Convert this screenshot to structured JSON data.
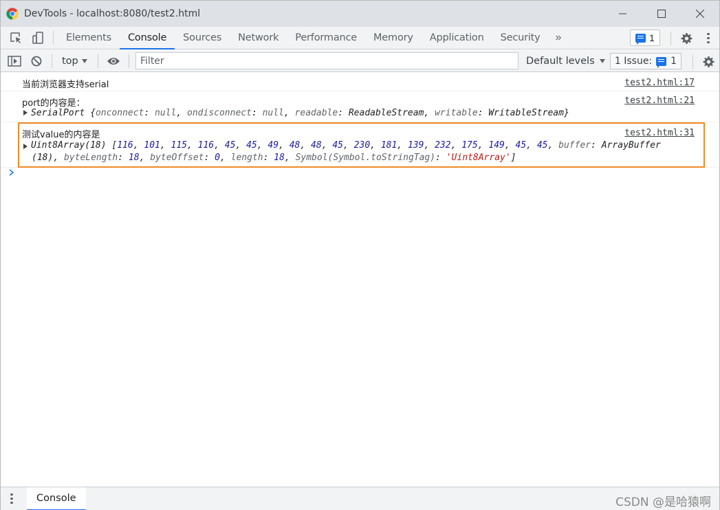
{
  "window": {
    "title": "DevTools - localhost:8080/test2.html",
    "controls": [
      "minimize",
      "maximize",
      "close"
    ]
  },
  "tabs": [
    {
      "label": "Elements",
      "active": false
    },
    {
      "label": "Console",
      "active": true
    },
    {
      "label": "Sources",
      "active": false
    },
    {
      "label": "Network",
      "active": false
    },
    {
      "label": "Performance",
      "active": false
    },
    {
      "label": "Memory",
      "active": false
    },
    {
      "label": "Application",
      "active": false
    },
    {
      "label": "Security",
      "active": false
    }
  ],
  "tab_more": "»",
  "issues_badge_count": "1",
  "console_toolbar": {
    "context": "top",
    "filter_placeholder": "Filter",
    "levels": "Default levels",
    "issue_label": "1 Issue:",
    "issue_count": "1"
  },
  "messages": [
    {
      "text": "当前浏览器支持serial",
      "source": "test2.html:17"
    },
    {
      "text": "port的内容是：",
      "source": "test2.html:21"
    },
    {
      "text": "测试value的内容是",
      "source": "test2.html:31"
    }
  ],
  "serial_port": {
    "name": "SerialPort",
    "props": [
      {
        "key": "onconnect",
        "value": "null"
      },
      {
        "key": "ondisconnect",
        "value": "null"
      },
      {
        "key": "readable",
        "value": "ReadableStream"
      },
      {
        "key": "writable",
        "value": "WritableStream"
      }
    ]
  },
  "uint8array": {
    "name": "Uint8Array(18)",
    "values": [
      116,
      101,
      115,
      116,
      45,
      45,
      49,
      48,
      48,
      45,
      230,
      181,
      139,
      232,
      175,
      149,
      45,
      45
    ],
    "buffer_label": "buffer",
    "buffer_value": "ArrayBuffer",
    "buffer_len": "(18)",
    "byteLength": "18",
    "byteOffset": "0",
    "length": "18",
    "tag_key": "Symbol(Symbol.toStringTag)",
    "tag_value": "'Uint8Array'"
  },
  "drawer": {
    "tab": "Console"
  },
  "watermark": "CSDN @是哈猿啊",
  "colors": {
    "accent": "#1a73e8",
    "highlight": "#f08a24",
    "number": "#1a1aa6",
    "string": "#c41a16"
  }
}
